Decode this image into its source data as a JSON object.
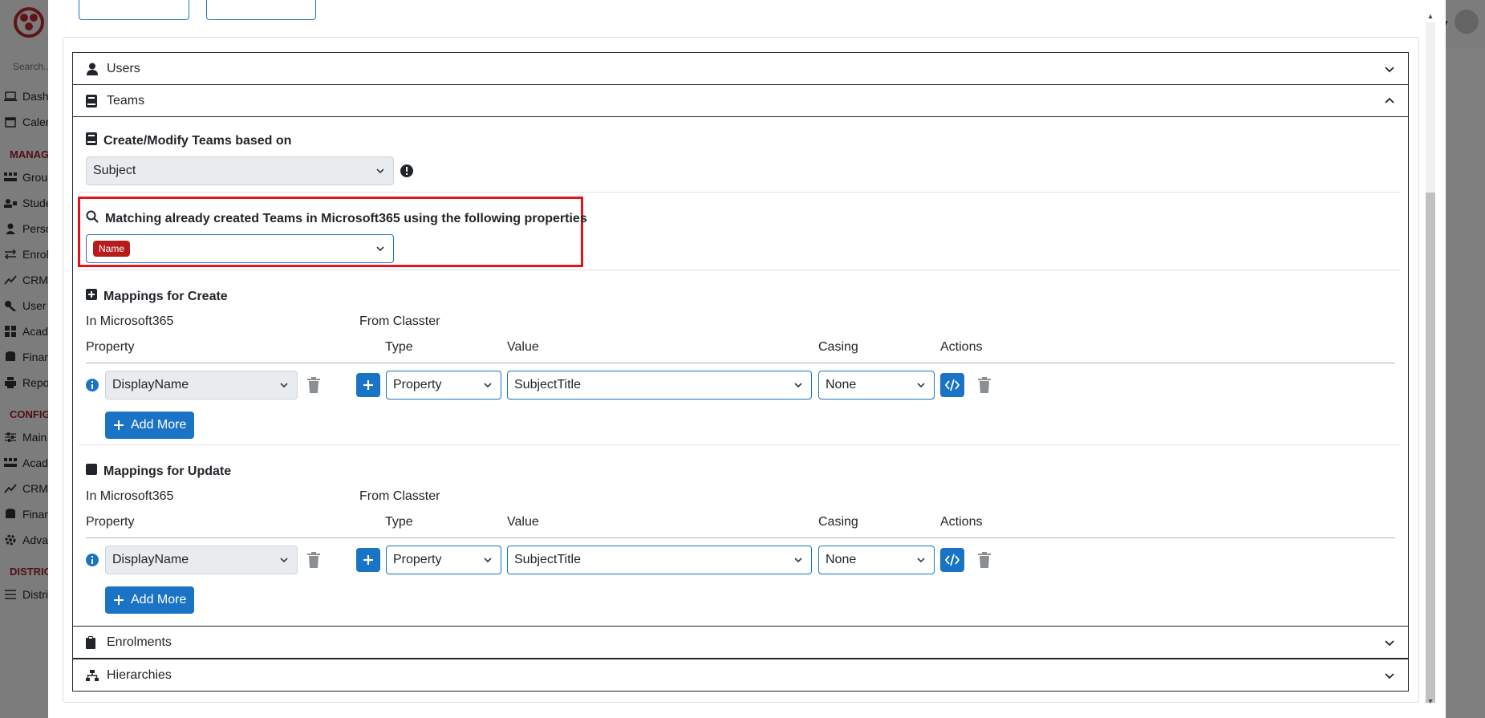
{
  "sidebar": {
    "search_placeholder": "Search...",
    "items_top": [
      {
        "label": "Dashb",
        "icon": "laptop-icon"
      },
      {
        "label": "Calen",
        "icon": "calendar-icon"
      }
    ],
    "manage_header": "MANAG",
    "items_manage": [
      {
        "label": "Group",
        "icon": "users-icon"
      },
      {
        "label": "Stude",
        "icon": "students-icon"
      },
      {
        "label": "Perso",
        "icon": "person-icon"
      },
      {
        "label": "Enrol",
        "icon": "exchange-icon"
      },
      {
        "label": "CRM",
        "icon": "chart-icon"
      },
      {
        "label": "User A",
        "icon": "key-icon"
      },
      {
        "label": "Acade",
        "icon": "grid-icon"
      },
      {
        "label": "Finan",
        "icon": "database-icon"
      },
      {
        "label": "Repor",
        "icon": "print-icon"
      }
    ],
    "config_header": "CONFIG",
    "items_config": [
      {
        "label": "Main",
        "icon": "sliders-icon"
      },
      {
        "label": "Acade",
        "icon": "users-icon"
      },
      {
        "label": "CRM S",
        "icon": "chart-icon"
      },
      {
        "label": "Finan",
        "icon": "database-icon"
      },
      {
        "label": "Advan",
        "icon": "gear-icon"
      }
    ],
    "district_header": "DISTRIC",
    "items_district": [
      {
        "label": "Distri",
        "icon": "list-icon"
      }
    ]
  },
  "accordion": {
    "users": "Users",
    "teams": "Teams",
    "enrolments": "Enrolments",
    "hierarchies": "Hierarchies"
  },
  "teams": {
    "create_modify_title": "Create/Modify Teams based on",
    "create_modify_value": "Subject",
    "matching_title": "Matching already created Teams in Microsoft365 using the following properties",
    "matching_badge": "Name",
    "mappings_create_title": "Mappings for Create",
    "mappings_update_title": "Mappings for Update",
    "col_in_m365": "In Microsoft365",
    "col_from_classter": "From Classter",
    "col_property": "Property",
    "col_type": "Type",
    "col_value": "Value",
    "col_casing": "Casing",
    "col_actions": "Actions",
    "create_row": {
      "property": "DisplayName",
      "type": "Property",
      "value": "SubjectTitle",
      "casing": "None"
    },
    "update_row": {
      "property": "DisplayName",
      "type": "Property",
      "value": "SubjectTitle",
      "casing": "None"
    },
    "add_more": "Add More"
  },
  "colors": {
    "primary": "#1a73c5",
    "badge": "#b71c1c",
    "highlight": "#e3131b",
    "brand_red": "#a31c29"
  }
}
